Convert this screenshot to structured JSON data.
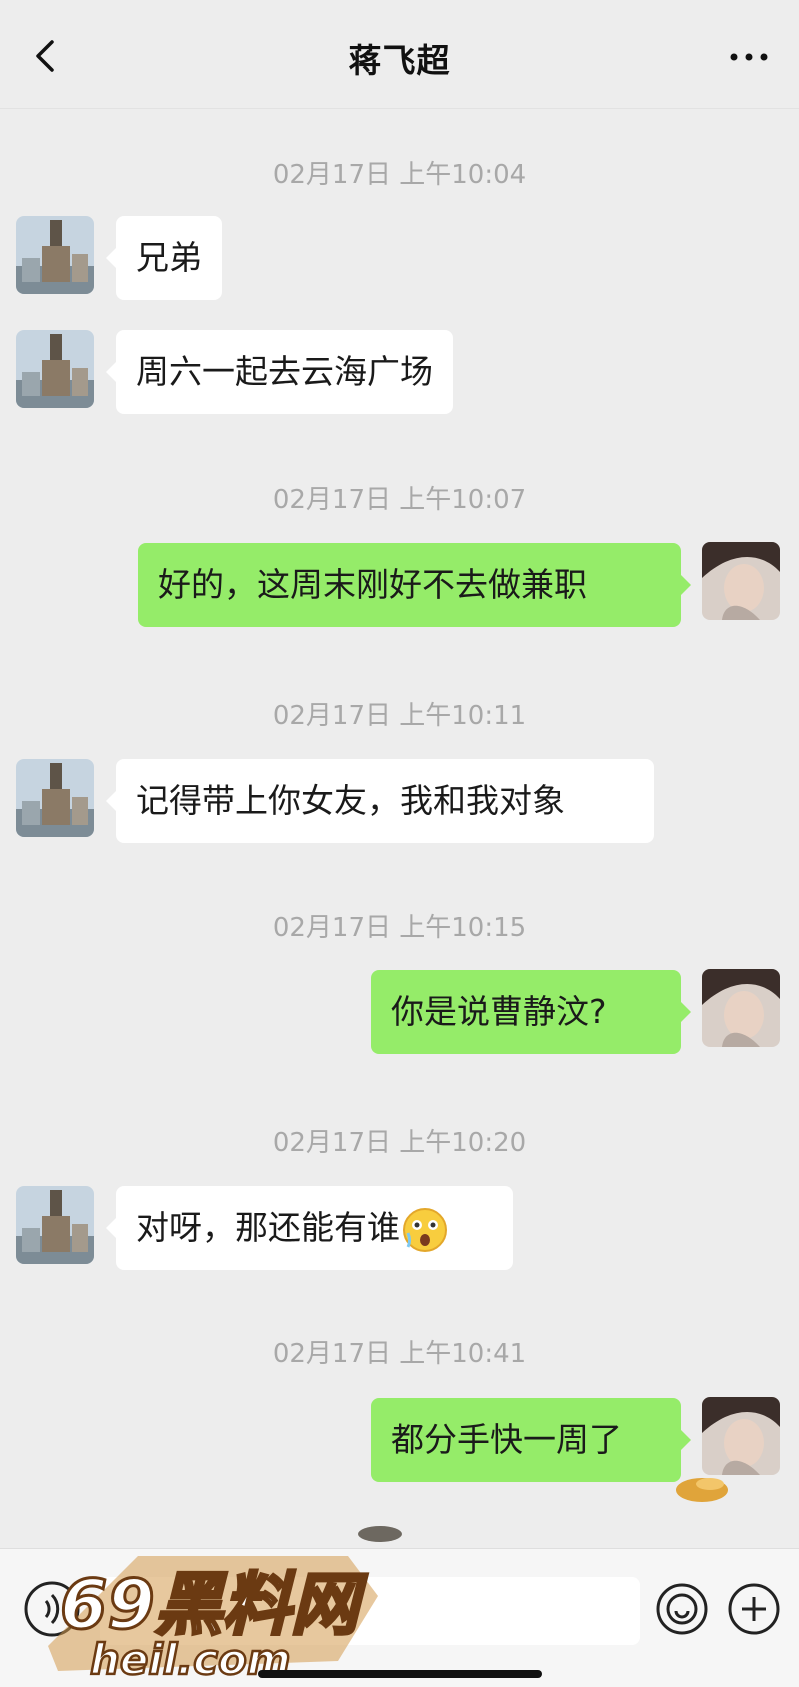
{
  "nav": {
    "back_icon": "chevron-left-icon",
    "title": "蒋飞超",
    "more_icon": "more-dots-icon"
  },
  "messages": [
    {
      "time": "02月17日 上午10:04"
    },
    {
      "side": "left",
      "text": "兄弟"
    },
    {
      "side": "left",
      "text": "周六一起去云海广场"
    },
    {
      "time": "02月17日 上午10:07"
    },
    {
      "side": "right",
      "text": "好的，这周末刚好不去做兼职"
    },
    {
      "time": "02月17日 上午10:11"
    },
    {
      "side": "left",
      "text": "记得带上你女友，我和我对象"
    },
    {
      "time": "02月17日 上午10:15"
    },
    {
      "side": "right",
      "text": "你是说曹静汶?"
    },
    {
      "time": "02月17日 上午10:20"
    },
    {
      "side": "left",
      "text": "对呀，那还能有谁",
      "emoji": "shocked-face-icon"
    },
    {
      "time": "02月17日 上午10:41"
    },
    {
      "side": "right",
      "text": "都分手快一周了"
    }
  ],
  "input_bar": {
    "voice_icon": "voice-icon",
    "sticker_icon": "sticker-icon",
    "plus_icon": "plus-icon"
  },
  "watermark": {
    "top": "69黑料网",
    "bottom": "heil.com"
  },
  "colors": {
    "background": "#ededed",
    "bubble_sent": "#95ec69",
    "bubble_received": "#ffffff",
    "timestamp": "#a8a8a8"
  }
}
